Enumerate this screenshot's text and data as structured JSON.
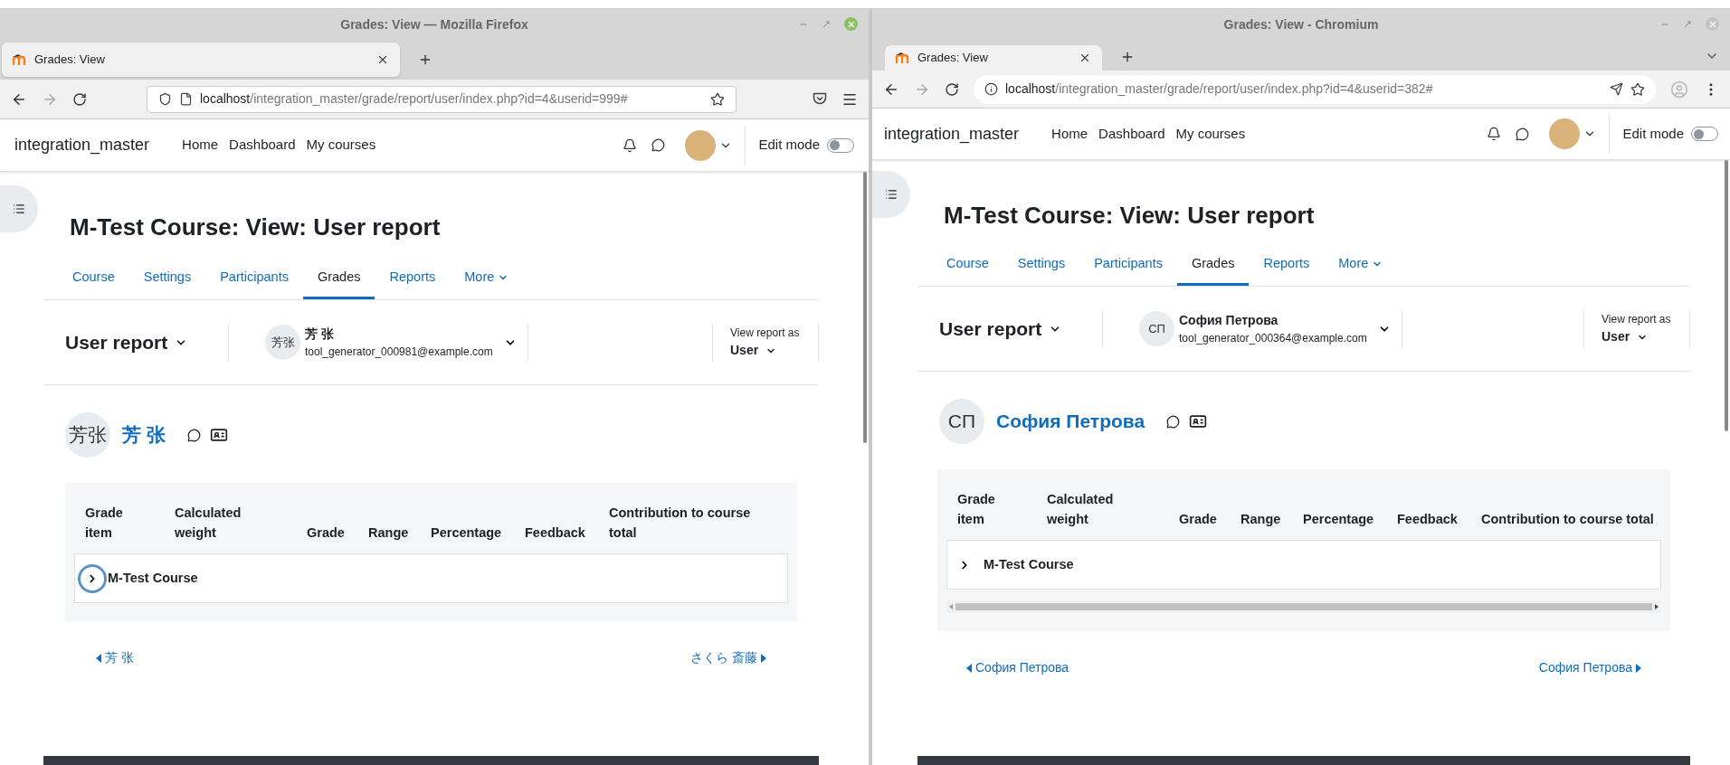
{
  "windows": [
    {
      "kind": "firefox",
      "title": "Grades: View — Mozilla Firefox",
      "tab": {
        "label": "Grades: View"
      },
      "url": {
        "host": "localhost",
        "path": "/integration_master/grade/report/user/index.php?id=4&userid=999#"
      },
      "site": {
        "name": "integration_master",
        "nav": [
          "Home",
          "Dashboard",
          "My courses"
        ],
        "edit_mode": {
          "label": "Edit mode",
          "on": false
        }
      },
      "page": {
        "heading": "M-Test Course: View: User report",
        "tabs": [
          {
            "label": "Course",
            "selected": false,
            "menu": false
          },
          {
            "label": "Settings",
            "selected": false,
            "menu": false
          },
          {
            "label": "Participants",
            "selected": false,
            "menu": false
          },
          {
            "label": "Grades",
            "selected": true,
            "menu": false
          },
          {
            "label": "Reports",
            "selected": false,
            "menu": false
          },
          {
            "label": "More",
            "selected": false,
            "menu": true
          }
        ],
        "report_selector": "User report",
        "user": {
          "initials": "芳张",
          "name": "芳 张",
          "email": "tool_generator_000981@example.com"
        },
        "view_as": {
          "label": "View report as",
          "value": "User"
        },
        "profile": {
          "initials": "芳张",
          "name": "芳 张"
        },
        "table": {
          "columns": [
            "Grade item",
            "Calculated weight",
            "Grade",
            "Range",
            "Percentage",
            "Feedback",
            "Contribution to course total"
          ],
          "rows": [
            {
              "label": "M-Test Course",
              "expanded": false,
              "focused": true
            }
          ]
        },
        "prev": "芳 张",
        "next": "さくら 斎藤"
      }
    },
    {
      "kind": "chromium",
      "title": "Grades: View - Chromium",
      "tab": {
        "label": "Grades: View"
      },
      "url": {
        "host": "localhost",
        "path": "/integration_master/grade/report/user/index.php?id=4&userid=382#"
      },
      "site": {
        "name": "integration_master",
        "nav": [
          "Home",
          "Dashboard",
          "My courses"
        ],
        "edit_mode": {
          "label": "Edit mode",
          "on": false
        }
      },
      "page": {
        "heading": "M-Test Course: View: User report",
        "tabs": [
          {
            "label": "Course",
            "selected": false,
            "menu": false
          },
          {
            "label": "Settings",
            "selected": false,
            "menu": false
          },
          {
            "label": "Participants",
            "selected": false,
            "menu": false
          },
          {
            "label": "Grades",
            "selected": true,
            "menu": false
          },
          {
            "label": "Reports",
            "selected": false,
            "menu": false
          },
          {
            "label": "More",
            "selected": false,
            "menu": true
          }
        ],
        "report_selector": "User report",
        "user": {
          "initials": "СП",
          "name": "София Петрова",
          "email": "tool_generator_000364@example.com"
        },
        "view_as": {
          "label": "View report as",
          "value": "User"
        },
        "profile": {
          "initials": "СП",
          "name": "София Петрова"
        },
        "table": {
          "columns": [
            "Grade item",
            "Calculated weight",
            "Grade",
            "Range",
            "Percentage",
            "Feedback",
            "Contribution to course total"
          ],
          "rows": [
            {
              "label": "M-Test Course",
              "expanded": false,
              "focused": false
            }
          ]
        },
        "prev": "София Петрова",
        "next": "София Петрова"
      }
    }
  ]
}
